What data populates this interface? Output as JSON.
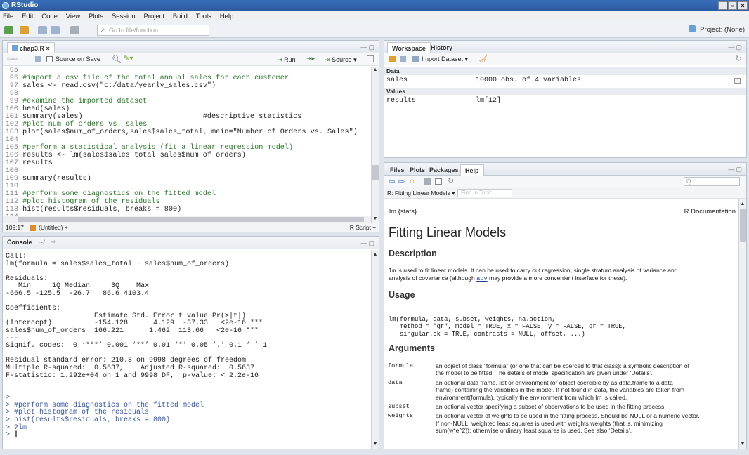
{
  "window": {
    "title": "RStudio"
  },
  "menu": [
    "File",
    "Edit",
    "Code",
    "View",
    "Plots",
    "Session",
    "Project",
    "Build",
    "Tools",
    "Help"
  ],
  "toolbar": {
    "goto_placeholder": "Go to file/function",
    "project": "Project: (None)"
  },
  "editor": {
    "tab_label": "chap3.R ×",
    "source_on_save": "Source on Save",
    "run_label": "Run",
    "source_label": "Source",
    "cursor_pos": "109:17",
    "scope": "(Untitled) ÷",
    "file_type": "R Script ÷",
    "lines": [
      {
        "n": "95",
        "t": ""
      },
      {
        "n": "96",
        "t": "#import a csv file of the total annual sales for each customer",
        "c": "cm"
      },
      {
        "n": "97",
        "t": "sales <- read.csv(\"c:/data/yearly_sales.csv\")"
      },
      {
        "n": "98",
        "t": ""
      },
      {
        "n": "99",
        "t": "#examine the imported dataset",
        "c": "cm"
      },
      {
        "n": "100",
        "t": "head(sales)"
      },
      {
        "n": "101",
        "t": "summary(sales)                            #descriptive statistics"
      },
      {
        "n": "102",
        "t": "#plot num_of_orders vs. sales",
        "c": "cm"
      },
      {
        "n": "103",
        "t": "plot(sales$num_of_orders,sales$sales_total, main=\"Number of Orders vs. Sales\")"
      },
      {
        "n": "104",
        "t": ""
      },
      {
        "n": "105",
        "t": "#perform a statistical analysis (fit a linear regression model)",
        "c": "cm"
      },
      {
        "n": "106",
        "t": "results <- lm(sales$sales_total~sales$num_of_orders)"
      },
      {
        "n": "107",
        "t": "results"
      },
      {
        "n": "108",
        "t": ""
      },
      {
        "n": "109",
        "t": "summary(results)"
      },
      {
        "n": "110",
        "t": ""
      },
      {
        "n": "111",
        "t": "#perform some diagnostics on the fitted model",
        "c": "cm"
      },
      {
        "n": "112",
        "t": "#plot histogram of the residuals",
        "c": "cm"
      },
      {
        "n": "113",
        "t": "hist(results$residuals, breaks = 800)"
      },
      {
        "n": "114",
        "t": ""
      }
    ]
  },
  "console": {
    "title": "Console",
    "path": "~/",
    "output": [
      "Call:",
      "lm(formula = sales$sales_total ~ sales$num_of_orders)",
      "",
      "Residuals:",
      "   Min     1Q Median     3Q    Max ",
      "-666.5 -125.5  -26.7   86.6 4103.4 ",
      "",
      "Coefficients:",
      "                     Estimate Std. Error t value Pr(>|t|)    ",
      "(Intercept)          -154.128      4.129  -37.33   <2e-16 ***",
      "sales$num_of_orders  166.221      1.462  113.66   <2e-16 ***",
      "---",
      "Signif. codes:  0 ‘***’ 0.001 ‘**’ 0.01 ‘*’ 0.05 ‘.’ 0.1 ‘ ’ 1 ",
      "",
      "Residual standard error: 210.8 on 9998 degrees of freedom",
      "Multiple R-squared:  0.5637,\tAdjusted R-squared:  0.5637 ",
      "F-statistic: 1.292e+04 on 1 and 9998 DF,  p-value: < 2.2e-16",
      "",
      ""
    ],
    "commands": [
      "",
      "#perform some diagnostics on the fitted model",
      "#plot histogram of the residuals",
      "hist(results$residuals, breaks = 800)",
      "?lm",
      ""
    ]
  },
  "workspace": {
    "tabs": [
      "Workspace",
      "History"
    ],
    "import_label": "Import Dataset ▾",
    "data_header": "Data",
    "values_header": "Values",
    "data_rows": [
      {
        "name": "sales",
        "value": "10000 obs. of 4 variables"
      }
    ],
    "value_rows": [
      {
        "name": "results",
        "value": "lm[12]"
      }
    ]
  },
  "files": {
    "tabs": [
      "Files",
      "Plots",
      "Packages",
      "Help"
    ],
    "topic_label": "R: Fitting Linear Models ▾",
    "find_placeholder": "Find in Topic",
    "search_placeholder": "Q"
  },
  "help": {
    "pkg": "lm {stats}",
    "rdoc": "R Documentation",
    "title": "Fitting Linear Models",
    "desc_h": "Description",
    "desc_1a": "lm",
    "desc_1b": " is used to fit linear models. It can be used to carry out regression, single stratum analysis of variance and",
    "desc_2a": "analysis of covariance (although ",
    "desc_2link": "aov",
    "desc_2b": " may provide a more convenient interface for these).",
    "usage_h": "Usage",
    "usage": [
      "lm(formula, data, subset, weights, na.action,",
      "   method = \"qr\", model = TRUE, x = FALSE, y = FALSE, qr = TRUE,",
      "   singular.ok = TRUE, contrasts = NULL, offset, ...)"
    ],
    "args_h": "Arguments",
    "args": [
      {
        "name": "formula",
        "lines": [
          "an object of class \"formula\" (or one that can be coerced to that class): a symbolic description of",
          "the model to be fitted. The details of model specification are given under ‘Details’."
        ]
      },
      {
        "name": "data",
        "lines": [
          "an optional data frame, list or environment (or object coercible by as.data.frame to a data",
          "frame) containing the variables in the model. If not found in data, the variables are taken from",
          "environment(formula), typically the environment from which lm is called."
        ]
      },
      {
        "name": "subset",
        "lines": [
          "an optional vector specifying a subset of observations to be used in the fitting process."
        ]
      },
      {
        "name": "weights",
        "lines": [
          "an optional vector of weights to be used in the fitting process. Should be NULL or a numeric vector.",
          "If non-NULL, weighted least squares is used with weights weights (that is, minimizing",
          "sum(w*e^2)); otherwise ordinary least squares is used. See also ‘Details’."
        ]
      }
    ]
  }
}
